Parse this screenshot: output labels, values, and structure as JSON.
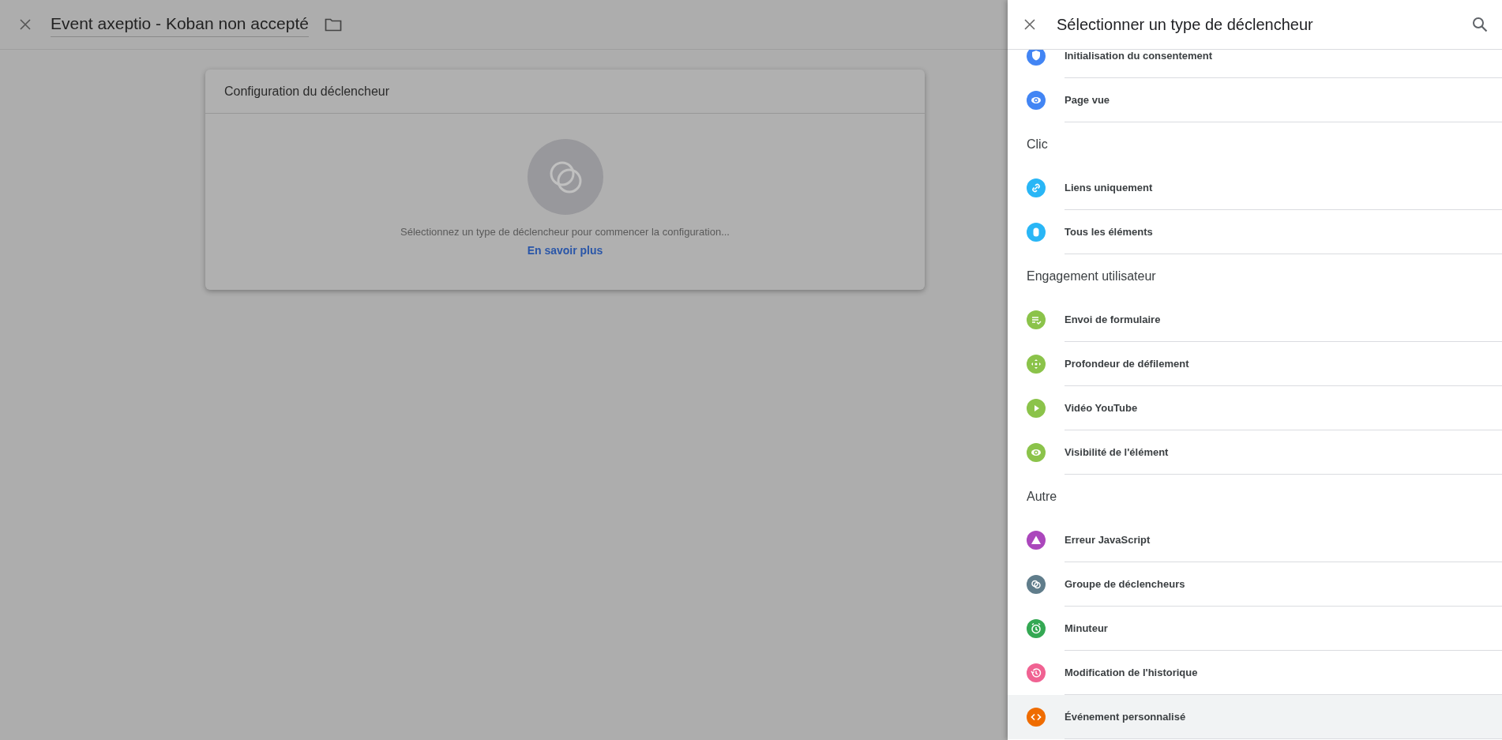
{
  "page": {
    "title": "Event axeptio - Koban non accepté"
  },
  "card": {
    "title": "Configuration du déclencheur",
    "message": "Sélectionnez un type de déclencheur pour commencer la configuration...",
    "link": "En savoir plus"
  },
  "panel": {
    "title": "Sélectionner un type de déclencheur",
    "groups": [
      {
        "items": [
          {
            "label": "Initialisation du consentement",
            "color": "#4285f4",
            "selected": false
          },
          {
            "label": "Page vue",
            "color": "#4285f4",
            "selected": false
          }
        ]
      },
      {
        "heading": "Clic",
        "items": [
          {
            "label": "Liens uniquement",
            "color": "#29b6f6",
            "selected": false
          },
          {
            "label": "Tous les éléments",
            "color": "#29b6f6",
            "selected": false
          }
        ]
      },
      {
        "heading": "Engagement utilisateur",
        "items": [
          {
            "label": "Envoi de formulaire",
            "color": "#8bc34a",
            "selected": false
          },
          {
            "label": "Profondeur de défilement",
            "color": "#8bc34a",
            "selected": false
          },
          {
            "label": "Vidéo YouTube",
            "color": "#8bc34a",
            "selected": false
          },
          {
            "label": "Visibilité de l'élément",
            "color": "#8bc34a",
            "selected": false
          }
        ]
      },
      {
        "heading": "Autre",
        "items": [
          {
            "label": "Erreur JavaScript",
            "color": "#ab47bc",
            "selected": false
          },
          {
            "label": "Groupe de déclencheurs",
            "color": "#607d8b",
            "selected": false
          },
          {
            "label": "Minuteur",
            "color": "#34a853",
            "selected": false
          },
          {
            "label": "Modification de l'historique",
            "color": "#f06292",
            "selected": false
          },
          {
            "label": "Événement personnalisé",
            "color": "#ef6c00",
            "selected": true
          }
        ]
      }
    ]
  }
}
